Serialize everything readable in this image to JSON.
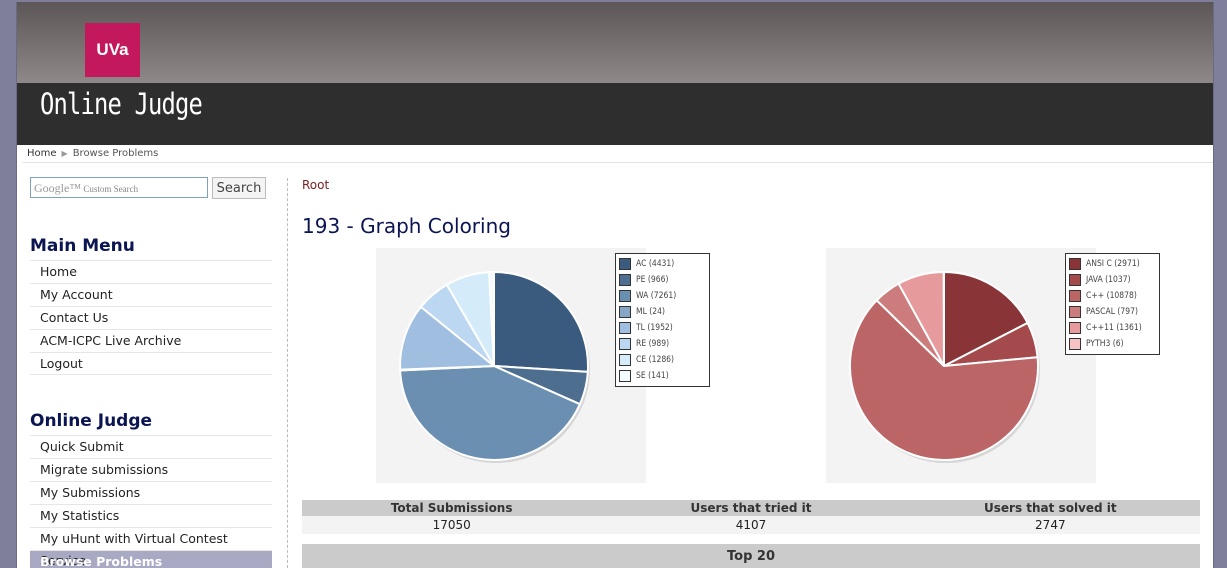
{
  "header": {
    "logo_text": "UVa",
    "site_title": "Online Judge"
  },
  "breadcrumb": {
    "home": "Home",
    "current": "Browse Problems"
  },
  "search": {
    "placeholder": "Custom Search",
    "google_label": "Google™",
    "button_label": "Search"
  },
  "main_menu": {
    "title": "Main Menu",
    "items": [
      "Home",
      "My Account",
      "Contact Us",
      "ACM-ICPC Live Archive",
      "Logout"
    ]
  },
  "online_judge_menu": {
    "title": "Online Judge",
    "items": [
      "Quick Submit",
      "Migrate submissions",
      "My Submissions",
      "My Statistics",
      "My uHunt with Virtual Contest Service",
      "Browse Problems"
    ],
    "active_index": 5
  },
  "content": {
    "root_link": "Root",
    "problem_title": "193 - Graph Coloring"
  },
  "chart_data": [
    {
      "type": "pie",
      "categories": [
        "AC",
        "PE",
        "WA",
        "ML",
        "TL",
        "RE",
        "CE",
        "SE"
      ],
      "values": [
        4431,
        966,
        7261,
        24,
        1952,
        989,
        1286,
        141
      ],
      "legend_labels": [
        "AC (4431)",
        "PE (966)",
        "WA (7261)",
        "ML (24)",
        "TL (1952)",
        "RE (989)",
        "CE (1286)",
        "SE (141)"
      ],
      "colors": [
        "#3b5b7e",
        "#4e6e90",
        "#6b8fb1",
        "#86a6c6",
        "#a0bfe0",
        "#bcd7f1",
        "#d4ecfa",
        "#f4fbff"
      ],
      "legend_placement": "right"
    },
    {
      "type": "pie",
      "categories": [
        "ANSI C",
        "JAVA",
        "C++",
        "PASCAL",
        "C++11",
        "PYTH3"
      ],
      "values": [
        2971,
        1037,
        10878,
        797,
        1361,
        6
      ],
      "legend_labels": [
        "ANSI C (2971)",
        "JAVA (1037)",
        "C++ (10878)",
        "PASCAL (797)",
        "C++11 (1361)",
        "PYTH3 (6)"
      ],
      "colors": [
        "#893538",
        "#a44a4c",
        "#bb6566",
        "#cc7c7d",
        "#e69a9b",
        "#f7c2c2"
      ],
      "legend_placement": "right"
    }
  ],
  "stats": {
    "headers": [
      "Total Submissions",
      "Users that tried it",
      "Users that solved it"
    ],
    "values": [
      "17050",
      "4107",
      "2747"
    ]
  },
  "top20_label": "Top 20"
}
